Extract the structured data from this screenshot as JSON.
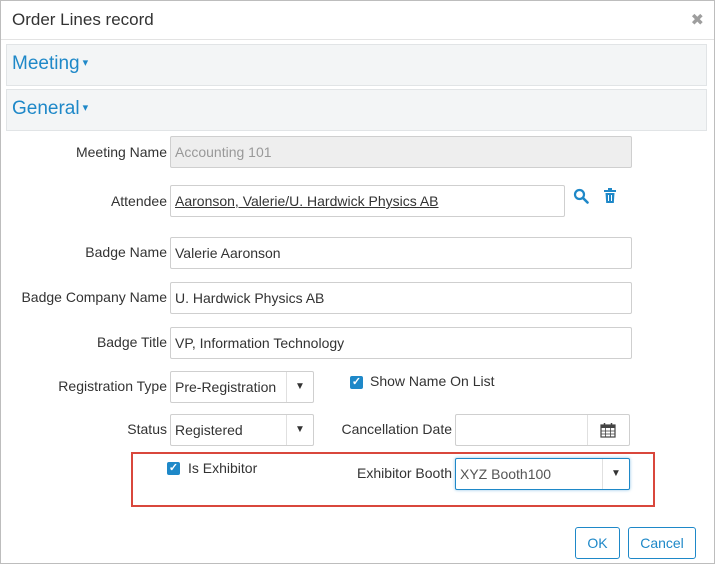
{
  "dialog": {
    "title": "Order Lines record",
    "close_icon": "close-icon"
  },
  "sections": {
    "meeting": {
      "label": "Meeting",
      "caret": "▾"
    },
    "general": {
      "label": "General",
      "caret": "▾"
    }
  },
  "form": {
    "meeting_name": {
      "label": "Meeting Name",
      "value": "Accounting 101"
    },
    "attendee": {
      "label": "Attendee",
      "value": "Aaronson, Valerie/U. Hardwick Physics AB"
    },
    "badge_name": {
      "label": "Badge Name",
      "value": "Valerie Aaronson"
    },
    "badge_company_name": {
      "label": "Badge Company Name",
      "value": "U. Hardwick Physics AB"
    },
    "badge_title": {
      "label": "Badge Title",
      "value": "VP, Information Technology"
    },
    "registration_type": {
      "label": "Registration Type",
      "value": "Pre-Registration"
    },
    "show_name_on_list": {
      "label": "Show Name On List",
      "checked": true
    },
    "status": {
      "label": "Status",
      "value": "Registered"
    },
    "cancellation_date": {
      "label": "Cancellation Date",
      "value": ""
    },
    "is_exhibitor": {
      "label": "Is Exhibitor",
      "checked": true
    },
    "exhibitor_booth": {
      "label": "Exhibitor Booth",
      "value": "XYZ Booth100"
    }
  },
  "buttons": {
    "ok": "OK",
    "cancel": "Cancel"
  },
  "colors": {
    "accent": "#1e88c8",
    "highlight": "#d9473c"
  }
}
